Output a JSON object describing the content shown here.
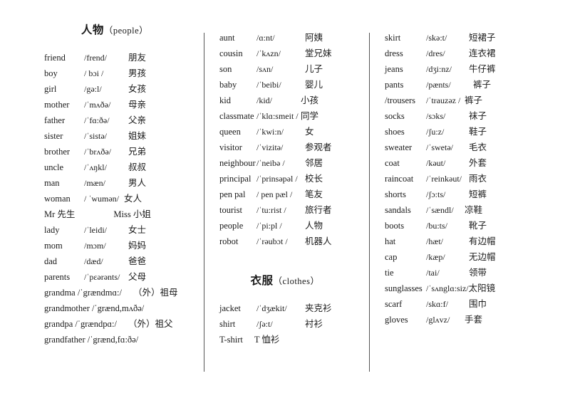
{
  "document": {
    "title": "英语词汇表 人物 衣服",
    "columns": [
      {
        "id": "column-people",
        "section": {
          "cn": "人物",
          "en": "（people）"
        },
        "entries": [
          {
            "word": "friend",
            "phon": "/frend/",
            "cn": "朋友"
          },
          {
            "word": "boy",
            "phon": "/ bɔi /",
            "cn": "男孩"
          },
          {
            "word": "girl",
            "phon": "/gə:l/",
            "cn": "女孩"
          },
          {
            "word": "mother",
            "phon": "/ˈmʌðə/",
            "cn": "母亲"
          },
          {
            "word": "father",
            "phon": "/ˈfɑ:ðə/",
            "cn": "父亲"
          },
          {
            "word": "sister",
            "phon": "/ˈsistə/",
            "cn": "姐妹"
          },
          {
            "word": "brother",
            "phon": "/ˈbrʌðə/",
            "cn": "兄弟"
          },
          {
            "word": "uncle",
            "phon": "/ˈʌŋkl/",
            "cn": "叔叔"
          },
          {
            "word": "man",
            "phon": "/mæn/",
            "cn": "男人"
          },
          {
            "word": "woman",
            "phon": "/ ˈwumən/",
            "cn": "女人"
          },
          {
            "word": "Mr 先生",
            "phon": "",
            "cn": "Miss 小姐",
            "free": true
          },
          {
            "word": "lady",
            "phon": "/ˈleidi/",
            "cn": "女士"
          },
          {
            "word": "mom",
            "phon": "/mɔm/",
            "cn": "妈妈"
          },
          {
            "word": "dad",
            "phon": "/dæd/",
            "cn": "爸爸"
          },
          {
            "word": "parents",
            "phon": "/ˈpɛərənts/",
            "cn": "父母"
          },
          {
            "word": "grandma /ˈgrændmɑ:/",
            "phon": "",
            "cn": "（外）祖母",
            "free": true
          },
          {
            "word": "grandmother /ˈgrænd,mʌðə/",
            "phon": "",
            "cn": "",
            "free": true
          },
          {
            "word": "grandpa /ˈgrændpɑ:/",
            "phon": "",
            "cn": "（外）祖父",
            "free": true
          },
          {
            "word": "grandfather /ˈgrænd,fɑ:ðə/",
            "phon": "",
            "cn": "",
            "free": true
          }
        ]
      },
      {
        "id": "column-people-2",
        "entries": [
          {
            "word": "aunt",
            "phon": "/ɑ:nt/",
            "cn": "阿姨"
          },
          {
            "word": "cousin",
            "phon": "/ˈkʌzn/",
            "cn": "堂兄妹"
          },
          {
            "word": "son",
            "phon": "/sʌn/",
            "cn": "儿子"
          },
          {
            "word": "baby",
            "phon": "/ˈbeibi/",
            "cn": "婴儿"
          },
          {
            "word": "kid",
            "phon": "/kid/",
            "cn": "小孩"
          },
          {
            "word": "classmate",
            "phon": "/ˈklɑ:smeit /",
            "cn": "同学"
          },
          {
            "word": "queen",
            "phon": "/ˈkwi:n/",
            "cn": "女"
          },
          {
            "word": "visitor",
            "phon": "/ˈvizitə/",
            "cn": "参观者"
          },
          {
            "word": "neighbour",
            "phon": "/ˈneibə /",
            "cn": "邻居"
          },
          {
            "word": "principal",
            "phon": "/ˈprinsəpəl /",
            "cn": "校长"
          },
          {
            "word": "pen pal",
            "phon": "/ pen pæl /",
            "cn": "笔友"
          },
          {
            "word": "tourist",
            "phon": "/ˈtu:rist /",
            "cn": "旅行者"
          },
          {
            "word": "people",
            "phon": "/ˈpi:pl /",
            "cn": "人物"
          },
          {
            "word": "robot",
            "phon": "/ˈrəubɔt /",
            "cn": "机器人"
          }
        ],
        "sub_section": {
          "cn": "衣服",
          "en": "（clothes）"
        },
        "sub_entries": [
          {
            "word": "jacket",
            "phon": "/ˈdʒækit/",
            "cn": "夹克衫"
          },
          {
            "word": "shirt",
            "phon": "/ʃə:t/",
            "cn": "衬衫"
          },
          {
            "word": "T-shirt",
            "phon": "",
            "cn": "T 恤衫",
            "free": true
          }
        ]
      },
      {
        "id": "column-clothes",
        "entries": [
          {
            "word": "skirt",
            "phon": "/skə:t/",
            "cn": "短裙子"
          },
          {
            "word": "dress",
            "phon": "/dres/",
            "cn": "连衣裙"
          },
          {
            "word": "jeans",
            "phon": "/dʒi:nz/",
            "cn": "牛仔裤"
          },
          {
            "word": "pants",
            "phon": "/pænts/",
            "cn": "裤子"
          },
          {
            "word": "/trousers",
            "phon": "/ˈtrauzəz /",
            "cn": "裤子"
          },
          {
            "word": "socks",
            "phon": "/sɔks/",
            "cn": "袜子"
          },
          {
            "word": "shoes",
            "phon": "/ʃu:z/",
            "cn": "鞋子"
          },
          {
            "word": "sweater",
            "phon": "/ˈswetə/",
            "cn": "毛衣"
          },
          {
            "word": "coat",
            "phon": "/kəut/",
            "cn": "外套"
          },
          {
            "word": "raincoat",
            "phon": "/ˈreinkəut/",
            "cn": "雨衣"
          },
          {
            "word": "shorts",
            "phon": "/ʃɔ:ts/",
            "cn": "短裤"
          },
          {
            "word": "sandals",
            "phon": "/ˈsændl/",
            "cn": "凉鞋"
          },
          {
            "word": "boots",
            "phon": "/bu:ts/",
            "cn": "靴子"
          },
          {
            "word": "hat",
            "phon": "/hæt/",
            "cn": "有边帽"
          },
          {
            "word": "cap",
            "phon": "/kæp/",
            "cn": "无边帽"
          },
          {
            "word": "tie",
            "phon": "/tai/",
            "cn": "领带"
          },
          {
            "word": "sunglasses",
            "phon": "/ˈsʌnglɑ:siz/",
            "cn": "太阳镜"
          },
          {
            "word": "scarf",
            "phon": "/skɑ:f/",
            "cn": "围巾"
          },
          {
            "word": "gloves",
            "phon": "/glʌvz/",
            "cn": "手套"
          }
        ]
      }
    ]
  }
}
